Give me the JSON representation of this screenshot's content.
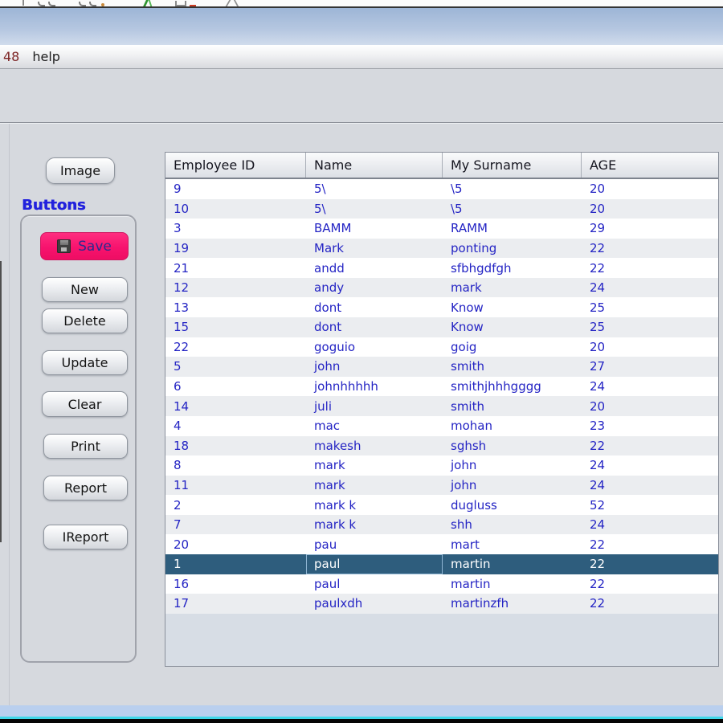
{
  "menu_bar": {
    "items": [
      {
        "label": "48",
        "color": "#7d2525"
      },
      {
        "label": "help",
        "color": "#1d1d1d"
      }
    ]
  },
  "left_panel": {
    "image_button_label": "Image",
    "group_label": "Buttons",
    "save_button": {
      "label": "Save",
      "icon": "floppy-disk-icon",
      "bg_color": "#f7136e",
      "text_color": "#2b2b8f"
    },
    "buttons": [
      "New",
      "Delete",
      "Update",
      "Clear",
      "Print",
      "Report",
      "IReport"
    ]
  },
  "table": {
    "columns": [
      "Employee ID",
      "Name",
      "My Surname",
      "AGE"
    ],
    "rows": [
      [
        "9",
        "5\\",
        "\\5",
        "20"
      ],
      [
        "10",
        "5\\",
        "\\5",
        "20"
      ],
      [
        "3",
        "BAMM",
        "RAMM",
        "29"
      ],
      [
        "19",
        "Mark",
        "ponting",
        "22"
      ],
      [
        "21",
        "andd",
        "sfbhgdfgh",
        "22"
      ],
      [
        "12",
        "andy",
        "mark",
        "24"
      ],
      [
        "13",
        "dont",
        "Know",
        "25"
      ],
      [
        "15",
        "dont",
        "Know",
        "25"
      ],
      [
        "22",
        "goguio",
        "goig",
        "20"
      ],
      [
        "5",
        "john",
        "smith",
        "27"
      ],
      [
        "6",
        "johnhhhhh",
        "smithjhhhgggg",
        "24"
      ],
      [
        "14",
        "juli",
        "smith",
        "20"
      ],
      [
        "4",
        "mac",
        "mohan",
        "23"
      ],
      [
        "18",
        "makesh",
        "sghsh",
        "22"
      ],
      [
        "8",
        "mark",
        "john",
        "24"
      ],
      [
        "11",
        "mark",
        "john",
        "24"
      ],
      [
        "2",
        "mark k",
        "dugluss",
        "52"
      ],
      [
        "7",
        "mark k",
        "shh",
        "24"
      ],
      [
        "20",
        "pau",
        "mart",
        "22"
      ],
      [
        "1",
        "paul",
        "martin",
        "22"
      ],
      [
        "16",
        "paul",
        "martin",
        "22"
      ],
      [
        "17",
        "paulxdh",
        "martinzfh",
        "22"
      ]
    ],
    "selected_id": "1",
    "focused_column_index": 1,
    "colors": {
      "selection_bg": "#2e5d7d",
      "selection_text": "#ffffff",
      "cell_text": "#2424c4",
      "alt_row_bg": "#ebedf0"
    }
  }
}
